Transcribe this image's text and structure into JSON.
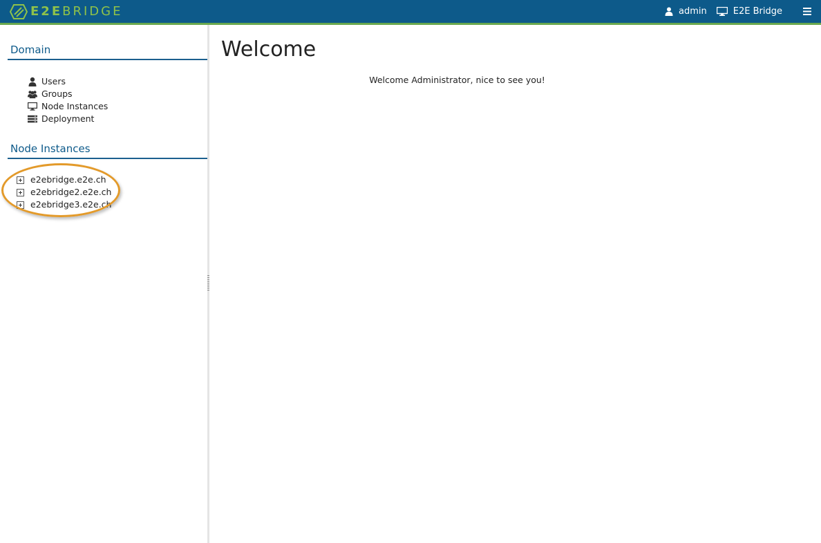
{
  "header": {
    "logo_bold": "E2E",
    "logo_light": "BRIDGE",
    "user_label": "admin",
    "system_label": "E2E Bridge",
    "icons": {
      "user": "user-icon",
      "system": "monitor-icon",
      "menu": "hamburger-menu-icon"
    },
    "colors": {
      "bar": "#0d5a8a",
      "accent": "#6aa84f",
      "logo": "#8fc24a"
    }
  },
  "sidebar": {
    "domain_title": "Domain",
    "domain_items": [
      {
        "label": "Users",
        "icon": "user-icon"
      },
      {
        "label": "Groups",
        "icon": "users-group-icon"
      },
      {
        "label": "Node Instances",
        "icon": "monitor-icon"
      },
      {
        "label": "Deployment",
        "icon": "server-stack-icon"
      }
    ],
    "nodes_title": "Node Instances",
    "nodes": [
      {
        "label": "e2ebridge.e2e.ch",
        "icon": "expand-plus-icon"
      },
      {
        "label": "e2ebridge2.e2e.ch",
        "icon": "expand-plus-icon"
      },
      {
        "label": "e2ebridge3.e2e.ch",
        "icon": "expand-plus-icon"
      }
    ],
    "highlight_color": "#e39a2a"
  },
  "main": {
    "title": "Welcome",
    "message": "Welcome Administrator, nice to see you!"
  }
}
